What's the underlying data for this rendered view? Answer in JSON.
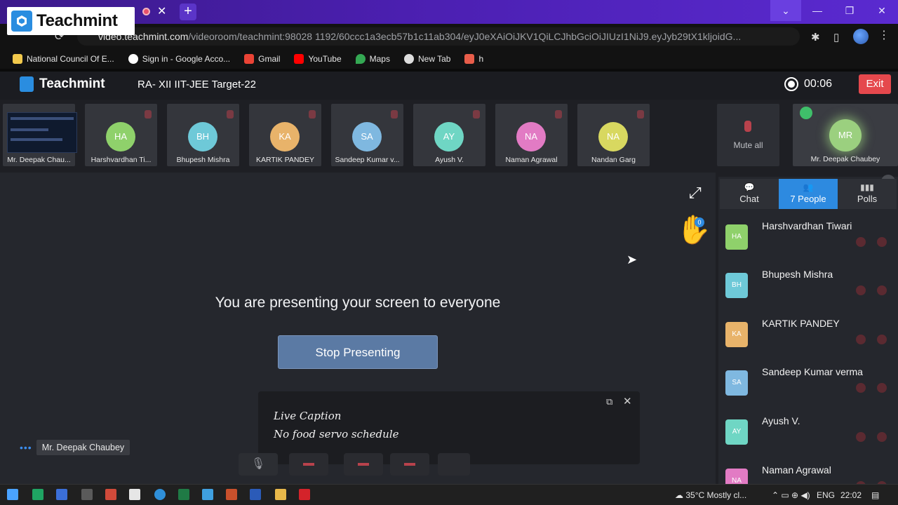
{
  "browser": {
    "badge_brand": "Teachmint",
    "url_host": "video.teachmint.com",
    "url_rest": "/videoroom/teachmint:98028 1192/60ccc1a3ecb57b1c11ab304/eyJ0eXAiOiJKV1QiLCJhbGciOiJIUzI1NiJ9.eyJyb29tX1kljoidG...",
    "window_controls": [
      "⌄",
      "—",
      "❐",
      "✕"
    ],
    "bookmarks": [
      {
        "label": "National Council Of E...",
        "icon": "ncert-icon",
        "color": "#f2c94c"
      },
      {
        "label": "Sign in - Google Acco...",
        "icon": "google-icon",
        "color": "#ffffff"
      },
      {
        "label": "Gmail",
        "icon": "gmail-icon",
        "color": "#ea4335"
      },
      {
        "label": "YouTube",
        "icon": "youtube-icon",
        "color": "#ff0000"
      },
      {
        "label": "Maps",
        "icon": "maps-icon",
        "color": "#34a853"
      },
      {
        "label": "New Tab",
        "icon": "globe-icon",
        "color": "#dddddd"
      },
      {
        "label": "h",
        "icon": "bookmark-h-icon",
        "color": "#e85d4a"
      }
    ]
  },
  "app": {
    "brand": "Teachmint",
    "room_title": "RA- XII IIT-JEE Target-22",
    "timer": "00:06",
    "exit_label": "Exit"
  },
  "participants": [
    {
      "name": "Mr. Deepak Chau...",
      "initials": "",
      "type": "screen"
    },
    {
      "name": "Harshvardhan Ti...",
      "initials": "HA",
      "color": "#8fd16b"
    },
    {
      "name": "Bhupesh Mishra",
      "initials": "BH",
      "color": "#6ec9d8"
    },
    {
      "name": "KARTIK PANDEY",
      "initials": "KA",
      "color": "#e8b36a"
    },
    {
      "name": "Sandeep Kumar v...",
      "initials": "SA",
      "color": "#7fb8e0"
    },
    {
      "name": "Ayush V.",
      "initials": "AY",
      "color": "#6fd6c4"
    },
    {
      "name": "Naman Agrawal",
      "initials": "NA",
      "color": "#e27bc4"
    },
    {
      "name": "Nandan Garg",
      "initials": "NA",
      "color": "#d8d860"
    }
  ],
  "mute_all_label": "Mute all",
  "self_tile": {
    "name": "Mr. Deepak Chaubey",
    "initials": "MR"
  },
  "stage": {
    "presenting_text": "You are presenting your screen to everyone",
    "stop_label": "Stop Presenting",
    "raised_hands": "0",
    "speaker_name": "Mr. Deepak Chaubey"
  },
  "caption": {
    "title": "Live Caption",
    "text": "No food servo schedule"
  },
  "panel": {
    "tabs": [
      {
        "label": "Chat",
        "icon": "chat-icon",
        "active": false
      },
      {
        "label": "7 People",
        "icon": "people-icon",
        "active": true
      },
      {
        "label": "Polls",
        "icon": "polls-icon",
        "active": false
      }
    ],
    "people": [
      {
        "name": "Harshvardhan Tiwari",
        "initials": "HA",
        "color": "#8fd16b"
      },
      {
        "name": "Bhupesh Mishra",
        "initials": "BH",
        "color": "#6ec9d8"
      },
      {
        "name": "KARTIK PANDEY",
        "initials": "KA",
        "color": "#e8b36a"
      },
      {
        "name": "Sandeep Kumar verma",
        "initials": "SA",
        "color": "#7fb8e0"
      },
      {
        "name": "Ayush V.",
        "initials": "AY",
        "color": "#6fd6c4"
      },
      {
        "name": "Naman Agrawal",
        "initials": "NA",
        "color": "#e27bc4"
      }
    ]
  },
  "taskbar": {
    "temperature": "35°C",
    "weather": "Mostly cl...",
    "lang": "ENG",
    "time": "22:02"
  }
}
